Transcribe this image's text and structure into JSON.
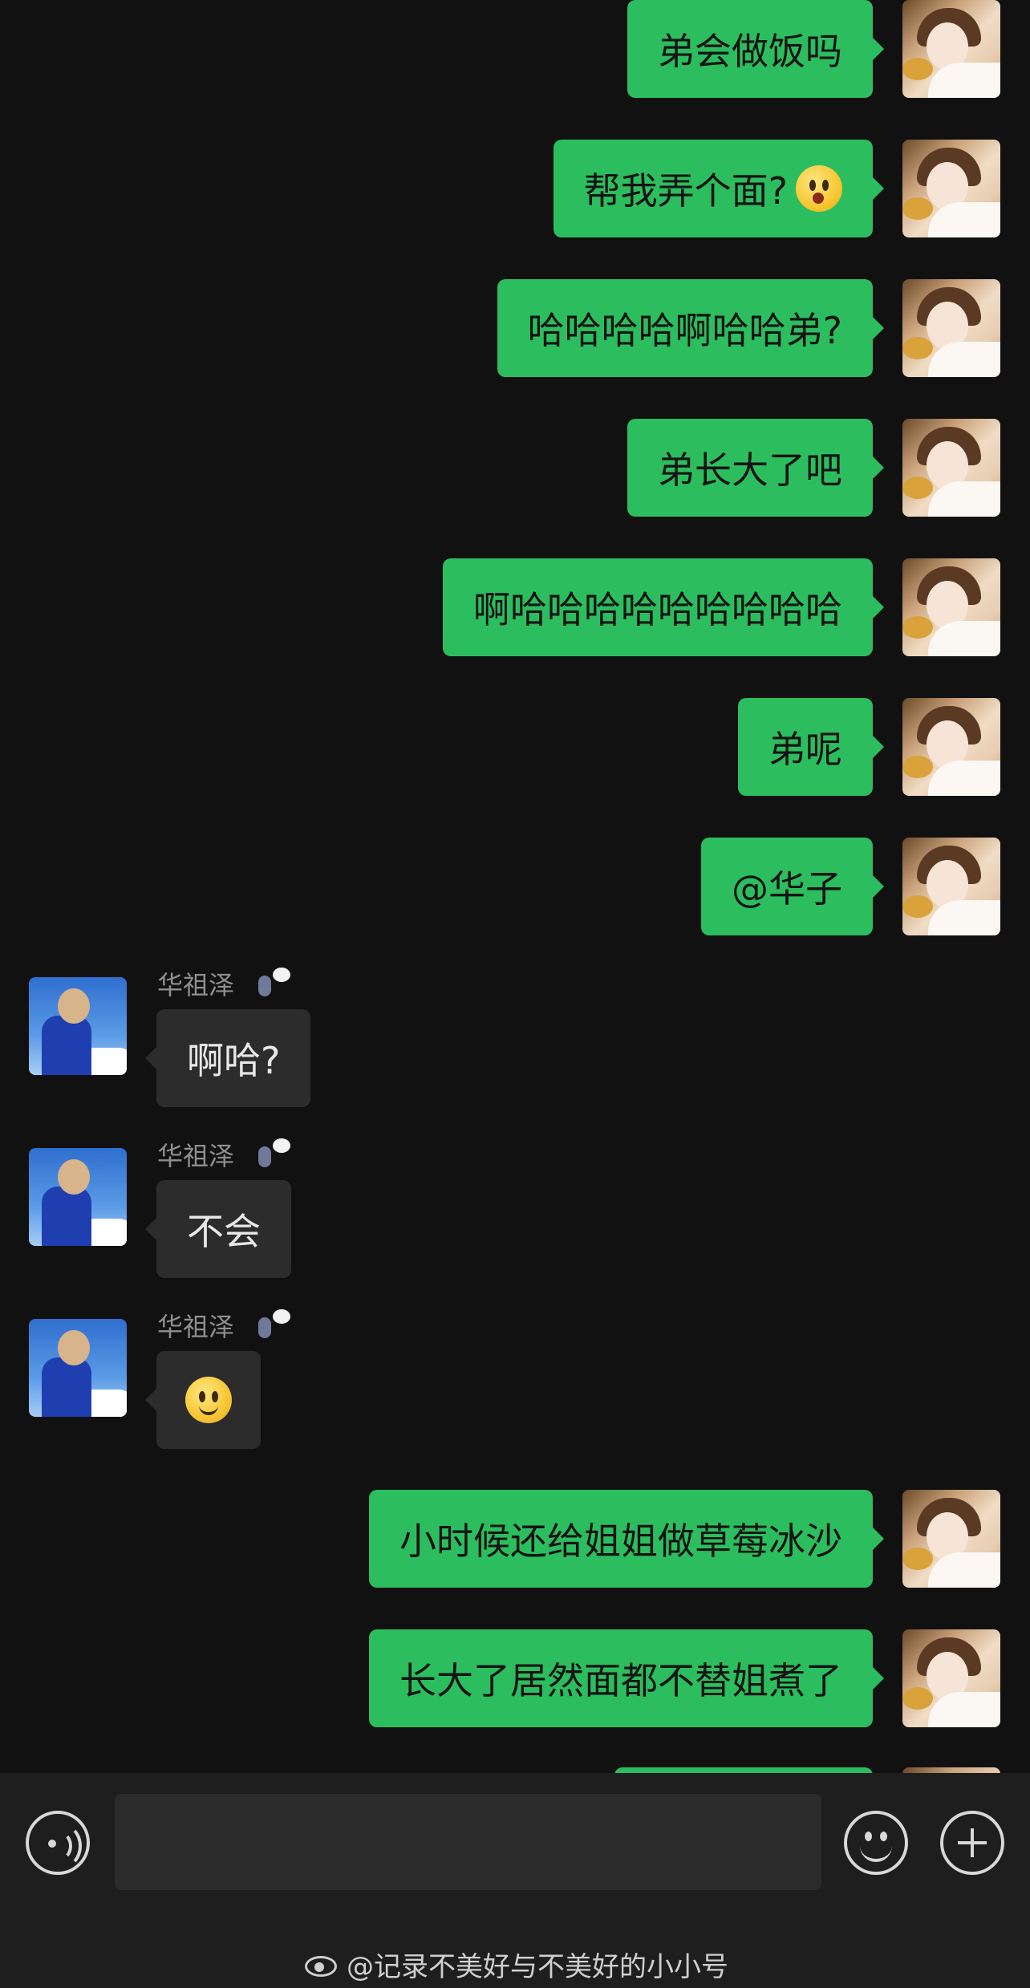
{
  "messages": [
    {
      "side": "out",
      "text": "弟会做饭吗"
    },
    {
      "side": "out",
      "text": "帮我弄个面?",
      "emoji": "shocked-face"
    },
    {
      "side": "out",
      "text": "哈哈哈哈啊哈哈弟?"
    },
    {
      "side": "out",
      "text": "弟长大了吧"
    },
    {
      "side": "out",
      "text": "啊哈哈哈哈哈哈哈哈哈"
    },
    {
      "side": "out",
      "text": "弟呢"
    },
    {
      "side": "out",
      "text": "@华子"
    },
    {
      "side": "in",
      "sender": "华祖泽",
      "text": "啊哈?"
    },
    {
      "side": "in",
      "sender": "华祖泽",
      "text": "不会"
    },
    {
      "side": "in",
      "sender": "华祖泽",
      "emoji": "smile-face"
    },
    {
      "side": "out",
      "text": "小时候还给姐姐做草莓冰沙"
    },
    {
      "side": "out",
      "text": "长大了居然面都不替姐煮了"
    }
  ],
  "input_bar": {
    "voice_icon": "voice-icon",
    "emoji_icon": "emoji-icon",
    "plus_icon": "plus-icon",
    "text_value": ""
  },
  "watermark": {
    "icon": "weibo-icon",
    "text": "@记录不美好与不美好的小小号"
  },
  "colors": {
    "background": "#111111",
    "outgoing_bubble": "#2cbd5e",
    "incoming_bubble": "#2c2c2c",
    "bottom_bar": "#1e1e1e"
  }
}
